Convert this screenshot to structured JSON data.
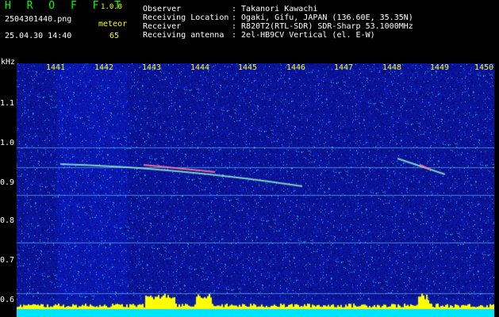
{
  "header": {
    "logo": "H R O F F T",
    "version": "1.0.0",
    "filename": "2504301440.png",
    "meteor_label": "meteor",
    "datetime": "25.04.30 14:40",
    "meteor_count": "65"
  },
  "info": [
    {
      "label": "Observer",
      "value": ": Takanori Kawachi"
    },
    {
      "label": "Receiving Location",
      "value": ": Ogaki, Gifu, JAPAN (136.60E, 35.35N)"
    },
    {
      "label": "Receiver",
      "value": ": R820T2(RTL-SDR) SDR-Sharp 53.1000MHz"
    },
    {
      "label": "Receiving antenna",
      "value": ": 2el-HB9CV Vertical (el. E-W)"
    }
  ],
  "axis": {
    "y_unit": "kHz",
    "y_labels": [
      "1.1",
      "1.0",
      "0.9",
      "0.8",
      "0.7",
      "0.6"
    ],
    "x_labels": [
      "1441",
      "1442",
      "1443",
      "1444",
      "1445",
      "1446",
      "1447",
      "1448",
      "1449",
      "1450"
    ]
  },
  "colors": {
    "background": "#000000",
    "spectrum_base": "#0b1f9e",
    "logo": "#00ff00",
    "accent": "#ffff00",
    "level_bar": "#00e5ff"
  }
}
